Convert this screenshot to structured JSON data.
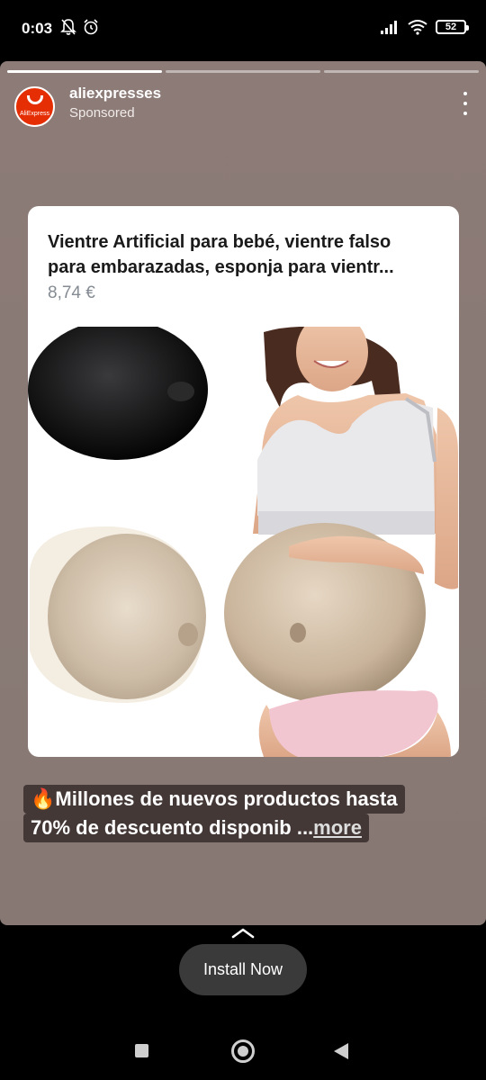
{
  "status_bar": {
    "time": "0:03",
    "battery": "52",
    "icons": [
      "bell-off-icon",
      "alarm-icon",
      "signal-icon",
      "wifi-icon",
      "battery-icon"
    ]
  },
  "story": {
    "progress_segments": 3,
    "active_segment": 1,
    "account_name": "aliexpresses",
    "account_sub": "Sponsored",
    "avatar_text": "AliExpress",
    "brand_color": "#e62e04"
  },
  "product": {
    "title_line1": "Vientre Artificial para bebé, vientre falso",
    "title_line2": "para embarazadas, esponja para vientr...",
    "price": "8,74 €"
  },
  "caption": {
    "emoji": "🔥",
    "line1": "Millones de nuevos productos hasta",
    "line2": "70% de descuento disponib ...",
    "more": "more"
  },
  "cta": {
    "label": "Install Now"
  },
  "nav": {
    "icons": [
      "recents-icon",
      "home-icon",
      "back-icon"
    ]
  }
}
